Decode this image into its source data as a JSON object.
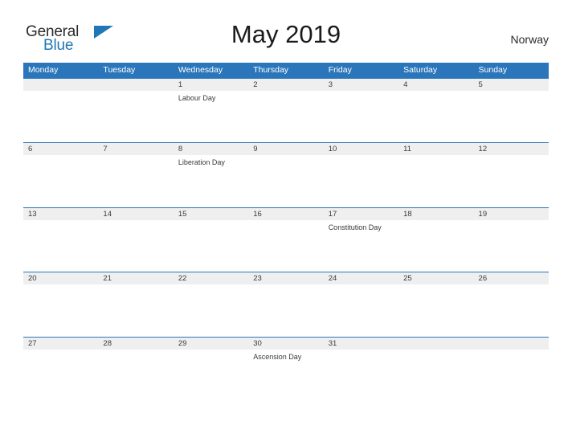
{
  "branding": {
    "logo_primary": "General",
    "logo_secondary": "Blue",
    "logo_triangle_icon": "triangle-icon",
    "accent_color": "#2b76ba",
    "logo_blue_color": "#2077b8"
  },
  "header": {
    "title": "May 2019",
    "country": "Norway"
  },
  "calendar": {
    "weekday_headers": [
      "Monday",
      "Tuesday",
      "Wednesday",
      "Thursday",
      "Friday",
      "Saturday",
      "Sunday"
    ],
    "header_bg": "#2b76ba",
    "daynum_bg": "#efefef",
    "weeks": [
      {
        "days": [
          {
            "num": "",
            "event": ""
          },
          {
            "num": "",
            "event": ""
          },
          {
            "num": "1",
            "event": "Labour Day"
          },
          {
            "num": "2",
            "event": ""
          },
          {
            "num": "3",
            "event": ""
          },
          {
            "num": "4",
            "event": ""
          },
          {
            "num": "5",
            "event": ""
          }
        ]
      },
      {
        "days": [
          {
            "num": "6",
            "event": ""
          },
          {
            "num": "7",
            "event": ""
          },
          {
            "num": "8",
            "event": "Liberation Day"
          },
          {
            "num": "9",
            "event": ""
          },
          {
            "num": "10",
            "event": ""
          },
          {
            "num": "11",
            "event": ""
          },
          {
            "num": "12",
            "event": ""
          }
        ]
      },
      {
        "days": [
          {
            "num": "13",
            "event": ""
          },
          {
            "num": "14",
            "event": ""
          },
          {
            "num": "15",
            "event": ""
          },
          {
            "num": "16",
            "event": ""
          },
          {
            "num": "17",
            "event": "Constitution Day"
          },
          {
            "num": "18",
            "event": ""
          },
          {
            "num": "19",
            "event": ""
          }
        ]
      },
      {
        "days": [
          {
            "num": "20",
            "event": ""
          },
          {
            "num": "21",
            "event": ""
          },
          {
            "num": "22",
            "event": ""
          },
          {
            "num": "23",
            "event": ""
          },
          {
            "num": "24",
            "event": ""
          },
          {
            "num": "25",
            "event": ""
          },
          {
            "num": "26",
            "event": ""
          }
        ]
      },
      {
        "days": [
          {
            "num": "27",
            "event": ""
          },
          {
            "num": "28",
            "event": ""
          },
          {
            "num": "29",
            "event": ""
          },
          {
            "num": "30",
            "event": "Ascension Day"
          },
          {
            "num": "31",
            "event": ""
          },
          {
            "num": "",
            "event": ""
          },
          {
            "num": "",
            "event": ""
          }
        ]
      }
    ]
  }
}
